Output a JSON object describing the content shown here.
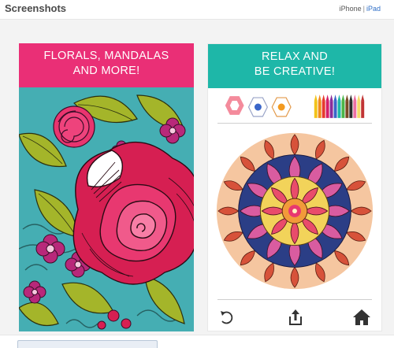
{
  "header": {
    "title": "Screenshots",
    "devices": [
      "iPhone",
      "iPad"
    ],
    "separator": "|",
    "selected_device": "iPad"
  },
  "screenshots": [
    {
      "banner_lines": [
        "FLORALS, MANDALAS",
        "AND MORE!"
      ],
      "banner_color": "#ea2f76"
    },
    {
      "banner_lines": [
        "RELAX AND",
        "BE CREATIVE!"
      ],
      "banner_color": "#1eb7a8",
      "toolbar_icons": [
        "undo-icon",
        "share-icon",
        "home-icon"
      ],
      "palette_icons": [
        "eraser-icon",
        "blue-color-swatch",
        "orange-color-swatch",
        "color-pencils-icon"
      ]
    }
  ],
  "colors": {
    "pink": "#ea2f76",
    "teal": "#1eb7a8",
    "link_blue": "#2f6fc7",
    "ipad_link": "#2f6fc7"
  }
}
